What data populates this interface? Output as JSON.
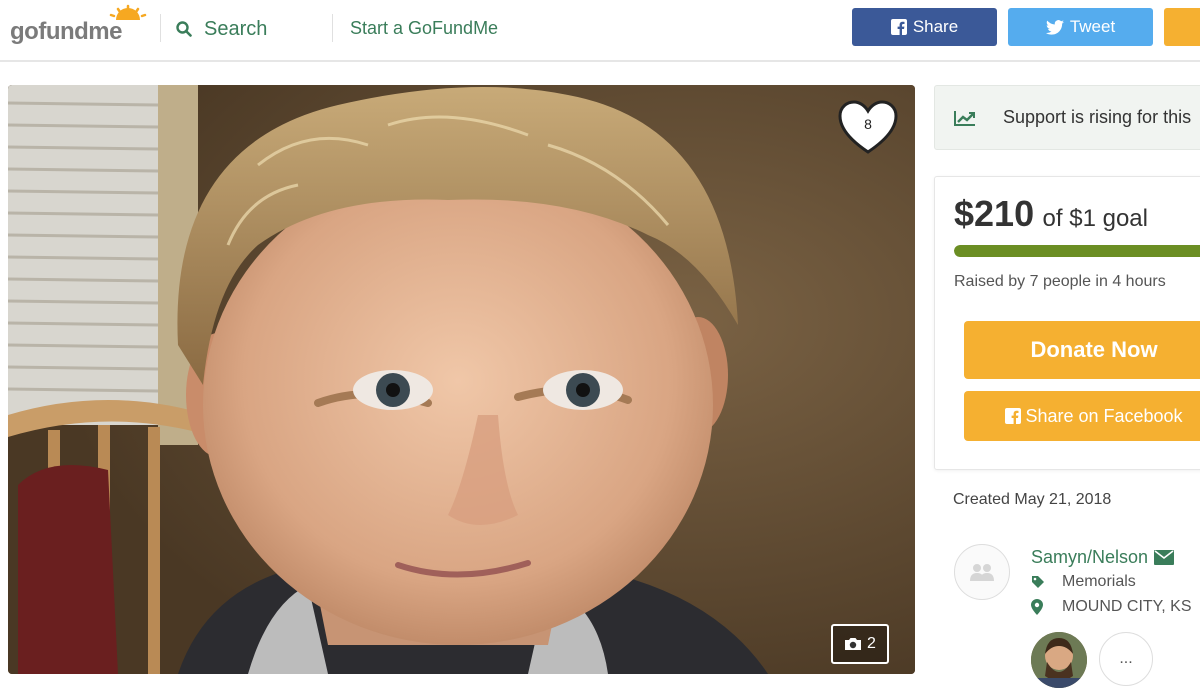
{
  "header": {
    "logo_text": "gofundme",
    "search_label": "Search",
    "start_label": "Start a GoFundMe",
    "share_label": "Share",
    "tweet_label": "Tweet"
  },
  "campaign": {
    "heart_count": "8",
    "photo_count": "2"
  },
  "sidebar": {
    "trend_text": "Support is rising for this",
    "raised_amount": "$210",
    "raised_goal": "of $1 goal",
    "progress_fraction": 1.0,
    "raised_by": "Raised by 7 people in 4 hours",
    "donate_label": "Donate Now",
    "share_facebook_label": "Share on Facebook",
    "created": "Created May 21, 2018",
    "organizer_name": "Samyn/Nelson",
    "category": "Memorials",
    "location": "MOUND CITY, KS",
    "more_label": "..."
  },
  "colors": {
    "brand_green": "#3a7d5a",
    "facebook_blue": "#3b5998",
    "twitter_blue": "#55acee",
    "donate_orange": "#f5b031",
    "progress_green": "#6b8e23"
  },
  "icons": {
    "search": "search-icon",
    "facebook": "facebook-icon",
    "twitter": "twitter-icon",
    "heart": "heart-icon",
    "camera": "camera-icon",
    "trend": "trend-up-icon",
    "email": "envelope-icon",
    "tag": "tag-icon",
    "location": "map-pin-icon"
  }
}
